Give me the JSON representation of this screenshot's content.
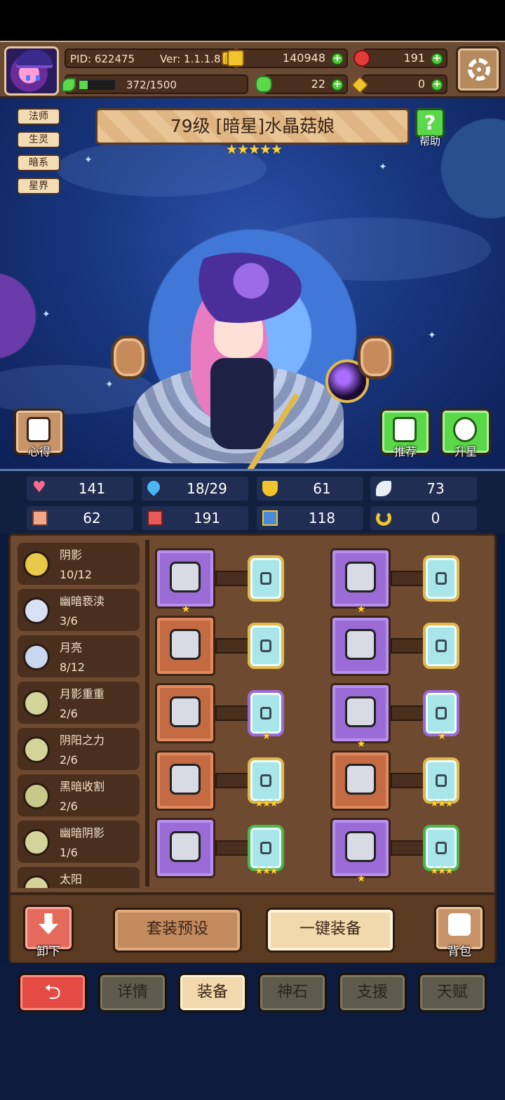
{
  "header": {
    "pid": "PID: 622475",
    "version": "Ver: 1.1.1.8",
    "xp": "372/1500",
    "xp_progress": 0.248,
    "gold": "140948",
    "gems": "191",
    "clovers": "22",
    "keys": "0"
  },
  "hero": {
    "tags": [
      "法师",
      "生灵",
      "暗系",
      "星界"
    ],
    "title": "79级 [暗星]水晶菇娘",
    "stars": "★★★★★",
    "help_label": "帮助",
    "notes_label": "心得",
    "recommend_label": "推荐",
    "upgrade_label": "升星"
  },
  "stats": [
    {
      "icon": "heart-icon",
      "value": "141"
    },
    {
      "icon": "mana-drop-icon",
      "value": "18/29"
    },
    {
      "icon": "shield-icon",
      "value": "61"
    },
    {
      "icon": "wing-icon",
      "value": "73"
    },
    {
      "icon": "fist-icon",
      "value": "62"
    },
    {
      "icon": "spellbook-icon",
      "value": "191"
    },
    {
      "icon": "armor-icon",
      "value": "118"
    },
    {
      "icon": "horseshoe-icon",
      "value": "0"
    }
  ],
  "sets": [
    {
      "name": "阴影",
      "progress": "10/12",
      "color": "#e8c94a"
    },
    {
      "name": "幽暗亵渎",
      "progress": "3/6",
      "color": "#d8e2f4"
    },
    {
      "name": "月亮",
      "progress": "8/12",
      "color": "#c8d8f0"
    },
    {
      "name": "月影重重",
      "progress": "2/6",
      "color": "#d4d49a"
    },
    {
      "name": "阴阳之力",
      "progress": "2/6",
      "color": "#d4d49a"
    },
    {
      "name": "黑暗收割",
      "progress": "2/6",
      "color": "#c8c888"
    },
    {
      "name": "幽暗阴影",
      "progress": "1/6",
      "color": "#d4d49a"
    },
    {
      "name": "太阳",
      "progress": "",
      "color": "#d4d49a"
    }
  ],
  "equipment": [
    {
      "slot": "weapon",
      "rarity": "purple",
      "stars": "★",
      "rune": "gold",
      "rune_stars": ""
    },
    {
      "slot": "helmet",
      "rarity": "purple",
      "stars": "★",
      "rune": "gold",
      "rune_stars": ""
    },
    {
      "slot": "dagger",
      "rarity": "orange",
      "stars": "",
      "rune": "gold",
      "rune_stars": ""
    },
    {
      "slot": "armor",
      "rarity": "purple",
      "stars": "",
      "rune": "gold",
      "rune_stars": ""
    },
    {
      "slot": "necklace",
      "rarity": "orange",
      "stars": "",
      "rune": "purple",
      "rune_stars": "★"
    },
    {
      "slot": "gloves",
      "rarity": "purple",
      "stars": "★",
      "rune": "purple",
      "rune_stars": "★"
    },
    {
      "slot": "amulet",
      "rarity": "orange",
      "stars": "",
      "rune": "gold",
      "rune_stars": "★★★"
    },
    {
      "slot": "ring-dark",
      "rarity": "orange",
      "stars": "",
      "rune": "gold",
      "rune_stars": "★★★"
    },
    {
      "slot": "ring",
      "rarity": "purple",
      "stars": "",
      "rune": "green",
      "rune_stars": "★★★"
    },
    {
      "slot": "boots",
      "rarity": "purple",
      "stars": "★",
      "rune": "green",
      "rune_stars": "★★★"
    }
  ],
  "actions": {
    "unload": "卸下",
    "preset": "套装预设",
    "equip_all": "一键装备",
    "bag": "背包"
  },
  "tabs": {
    "back": "⮌",
    "details": "详情",
    "equip": "装备",
    "stone": "神石",
    "support": "支援",
    "talent": "天赋"
  }
}
